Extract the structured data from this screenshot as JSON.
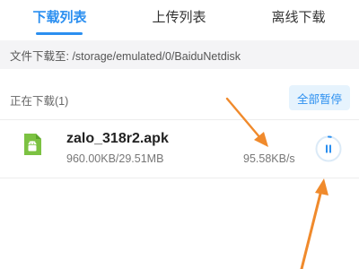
{
  "tabs": [
    {
      "label": "下载列表",
      "active": true
    },
    {
      "label": "上传列表",
      "active": false
    },
    {
      "label": "离线下载",
      "active": false
    }
  ],
  "path_bar": {
    "text": "文件下载至: /storage/emulated/0/BaiduNetdisk"
  },
  "section": {
    "title": "正在下载(1)",
    "pause_all_label": "全部暂停"
  },
  "downloads": [
    {
      "name": "zalo_318r2.apk",
      "size": "960.00KB/29.51MB",
      "speed": "95.58KB/s",
      "icon": "android-apk-icon",
      "progress": 0.032
    }
  ],
  "colors": {
    "accent": "#2b8ff0",
    "apk_green": "#7cc242",
    "annotation_arrow": "#f08a2c"
  }
}
